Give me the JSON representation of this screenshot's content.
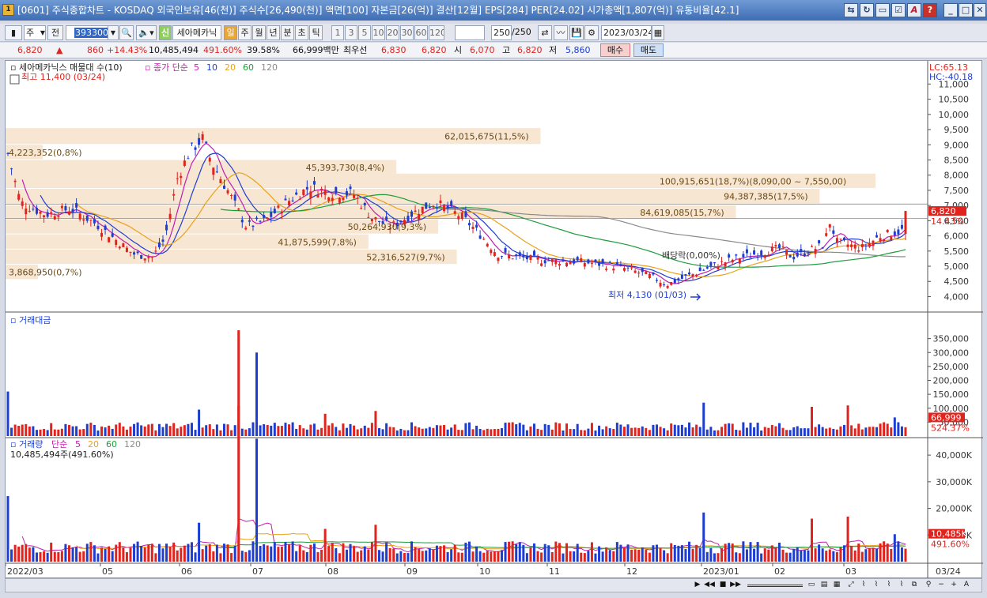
{
  "window": {
    "title": "[0601] 주식종합차트 - KOSDAQ 외국인보유[46(천)] 주식수[26,490(천)] 액면[100] 자본금[26(억)] 결산[12월] EPS[284] PER[24.02] 시가총액[1,807(억)] 유통비율[42.1]",
    "icon_label": "1"
  },
  "toolbar": {
    "period_select": "주",
    "prev_label": "전",
    "code": "393300",
    "stock_tag": "신",
    "stock_name": "세아메카닉",
    "periods": [
      "일",
      "주",
      "월",
      "년",
      "분",
      "초",
      "틱"
    ],
    "active_period": "일",
    "intervals": [
      "1",
      "3",
      "5",
      "10",
      "20",
      "30",
      "60",
      "120"
    ],
    "count_value": "250",
    "count_total": "/250",
    "date": "2023/03/24"
  },
  "info": {
    "price": "6,820",
    "change": "860",
    "change_pct": "+14.43%",
    "volume": "10,485,494",
    "volume_ratio": "491.60%",
    "turnover": "39.58%",
    "amount": "66,999백만",
    "best_label": "최우선",
    "ask": "6,830",
    "bid": "6,820",
    "open_label": "시",
    "open": "6,070",
    "high_label": "고",
    "high": "6,820",
    "low_label": "저",
    "low": "5,860",
    "buy_label": "매수",
    "sell_label": "매도"
  },
  "price_panel": {
    "legend_title": "세아메카닉스 매물대 수(10)",
    "ma_label": "종가 단순",
    "ma_periods": [
      "5",
      "10",
      "20",
      "60",
      "120"
    ],
    "ma_colors": [
      "#c01fb0",
      "#1e3ed1",
      "#e8a21a",
      "#1c9c3c",
      "#8a8a8a"
    ],
    "high_note": "최고 11,400 (03/24)",
    "low_note": "최저 4,130 (01/03)",
    "dividend_note": "배당락(0,00%)",
    "lc": "LC:65.13",
    "hc": "HC:-40.18",
    "current_price": "6,820",
    "current_pct": "14.43%",
    "y_ticks": [
      "11,000",
      "10,500",
      "10,000",
      "9,500",
      "9,000",
      "8,500",
      "8,000",
      "7,500",
      "7,000",
      "6,500",
      "6,000",
      "5,500",
      "5,000",
      "4,500",
      "4,000"
    ],
    "volume_profile": [
      {
        "label": "4,223,352(0,8%)",
        "price_hi": 9000,
        "price_lo": 8500
      },
      {
        "label": "62,015,675(11,5%)",
        "price_hi": 9550,
        "price_lo": 9000
      },
      {
        "label": "45,393,730(8,4%)",
        "price_hi": 8500,
        "price_lo": 8000
      },
      {
        "label": "100,915,651(18,7%)(8,090,00 ~ 7,550,00)",
        "price_hi": 8050,
        "price_lo": 7550
      },
      {
        "label": "94,387,385(17,5%)",
        "price_hi": 7550,
        "price_lo": 7050
      },
      {
        "label": "84,619,085(15,7%)",
        "price_hi": 7000,
        "price_lo": 6550
      },
      {
        "label": "50,264,930(9,3%)",
        "price_hi": 6550,
        "price_lo": 6050
      },
      {
        "label": "41,875,599(7,8%)",
        "price_hi": 6050,
        "price_lo": 5550
      },
      {
        "label": "52,316,527(9,7%)",
        "price_hi": 5550,
        "price_lo": 5050
      },
      {
        "label": "3,868,950(0,7%)",
        "price_hi": 5050,
        "price_lo": 4550
      }
    ]
  },
  "amount_panel": {
    "title": "거래대금",
    "y_ticks": [
      "350,000",
      "300,000",
      "250,000",
      "200,000",
      "150,000",
      "100,000",
      "50,000"
    ],
    "current": "66,999",
    "current_pct": "524.37%"
  },
  "volume_panel": {
    "title": "거래량",
    "ma_label": "단순",
    "ma_periods": [
      "5",
      "20",
      "60",
      "120"
    ],
    "value_note": "10,485,494주(491.60%)",
    "y_ticks": [
      "40,000K",
      "30,000K",
      "20,000K",
      "10,000K"
    ],
    "current": "10,485K",
    "current_pct": "491.60%"
  },
  "x_axis": {
    "labels": [
      "2022/03",
      "05",
      "06",
      "07",
      "08",
      "09",
      "10",
      "11",
      "12",
      "2023/01",
      "02",
      "03"
    ],
    "right_label": "03/24"
  },
  "colors": {
    "up": "#e0231d",
    "down": "#1e3ed1",
    "profile": "#f7e6d2",
    "profile_text": "#6b4a16"
  }
}
